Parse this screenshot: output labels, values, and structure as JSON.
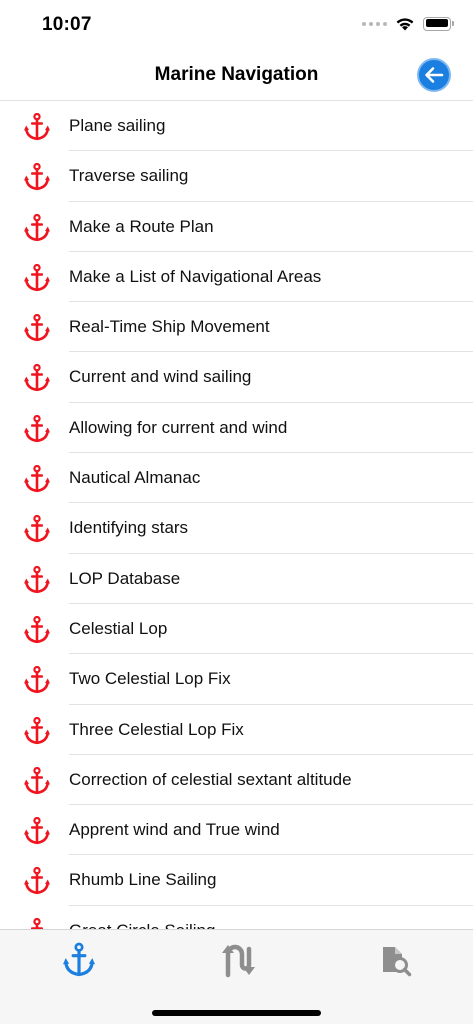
{
  "status_bar": {
    "time": "10:07"
  },
  "nav": {
    "title": "Marine Navigation",
    "back_icon": "back-arrow-icon"
  },
  "colors": {
    "anchor": "#f0141e",
    "accent": "#1a7fe0",
    "tab_inactive": "#8e8e8e"
  },
  "list": {
    "items": [
      {
        "label": "Plane sailing"
      },
      {
        "label": "Traverse sailing"
      },
      {
        "label": "Make a Route Plan"
      },
      {
        "label": "Make a List of Navigational Areas"
      },
      {
        "label": "Real-Time Ship Movement"
      },
      {
        "label": "Current and wind sailing"
      },
      {
        "label": "Allowing for current and wind"
      },
      {
        "label": "Nautical Almanac"
      },
      {
        "label": "Identifying stars"
      },
      {
        "label": "LOP Database"
      },
      {
        "label": "Celestial Lop"
      },
      {
        "label": "Two Celestial Lop Fix"
      },
      {
        "label": "Three Celestial Lop Fix"
      },
      {
        "label": "Correction of celestial sextant altitude"
      },
      {
        "label": "Apprent wind and True wind"
      },
      {
        "label": "Rhumb Line Sailing"
      },
      {
        "label": "Great Circle Sailing"
      }
    ]
  },
  "tab_bar": {
    "tabs": [
      {
        "icon": "anchor-icon",
        "selected": true
      },
      {
        "icon": "route-arrows-icon",
        "selected": false
      },
      {
        "icon": "document-search-icon",
        "selected": false
      }
    ]
  }
}
